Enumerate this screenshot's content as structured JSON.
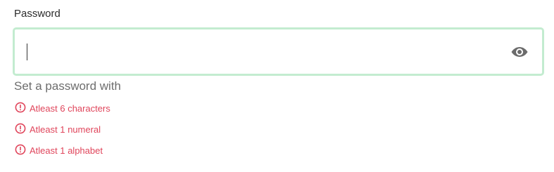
{
  "password_field": {
    "label": "Password",
    "value": "",
    "placeholder": "",
    "input_type": "password",
    "toggle_icon": "eye-icon",
    "focus_border_color": "#c3ecd0"
  },
  "helper": {
    "text": "Set a password with"
  },
  "requirements": [
    {
      "text": "Atleast 6 characters",
      "icon": "alert-circle-icon",
      "status": "unmet"
    },
    {
      "text": "Atleast 1 numeral",
      "icon": "alert-circle-icon",
      "status": "unmet"
    },
    {
      "text": "Atleast 1 alphabet",
      "icon": "alert-circle-icon",
      "status": "unmet"
    }
  ],
  "colors": {
    "error": "#e0455b",
    "label": "#2b2b2b",
    "helper": "#6d6d6d",
    "icon": "#6b6b6b"
  }
}
